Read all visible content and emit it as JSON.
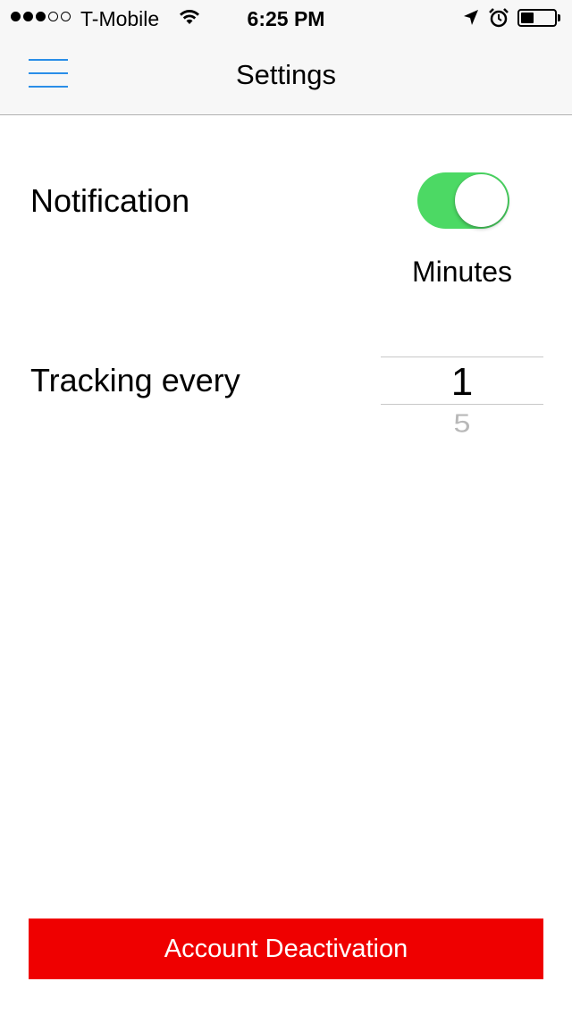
{
  "status_bar": {
    "carrier": "T-Mobile",
    "time": "6:25 PM",
    "signal_strength": 3,
    "signal_max": 5,
    "battery_level": 0.4
  },
  "nav": {
    "title": "Settings",
    "menu_icon": "hamburger-menu-icon"
  },
  "settings": {
    "notification_label": "Notification",
    "notification_enabled": true,
    "minutes_label": "Minutes",
    "tracking_label": "Tracking every",
    "tracking_selected": "1",
    "tracking_next_option": "5"
  },
  "footer": {
    "deactivate_label": "Account Deactivation"
  },
  "colors": {
    "accent": "#2a8ee8",
    "toggle_on": "#4cd964",
    "danger": "#ef0000"
  }
}
